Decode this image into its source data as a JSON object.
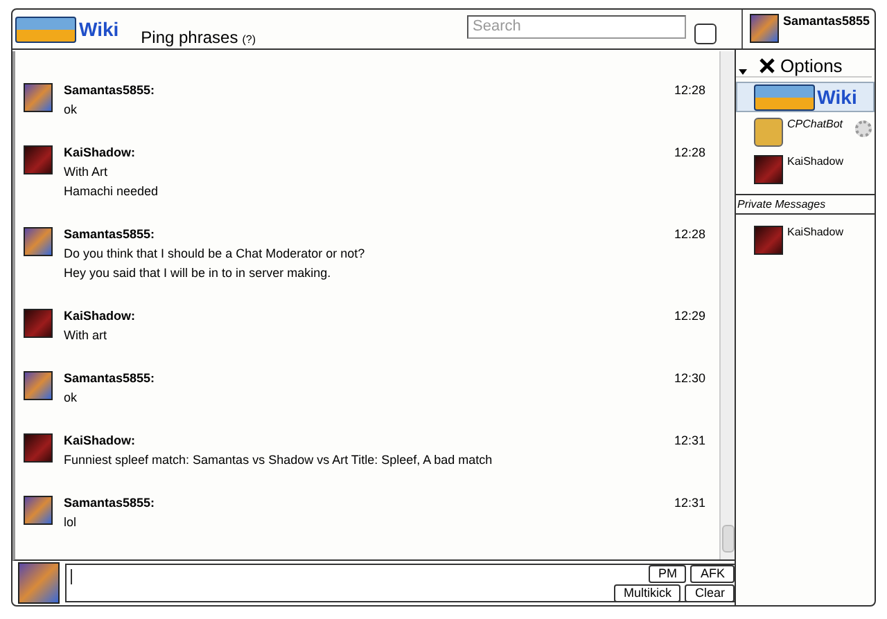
{
  "header": {
    "logo_text": "Wiki",
    "room": "Ping phrases",
    "room_help": "(?)",
    "search": {
      "placeholder": "Search"
    },
    "user": "Samantas5855"
  },
  "messages": [
    {
      "user": "Samantas5855:",
      "time": "12:28",
      "lines": [
        "ok"
      ],
      "kind": "samantas"
    },
    {
      "user": "KaiShadow:",
      "time": "12:28",
      "lines": [
        "With Art",
        "Hamachi needed"
      ],
      "kind": "kai"
    },
    {
      "user": "Samantas5855:",
      "time": "12:28",
      "lines": [
        "Do you think that I should be a Chat Moderator or not?",
        "Hey you said that I will be in to in server making."
      ],
      "kind": "samantas"
    },
    {
      "user": "KaiShadow:",
      "time": "12:29",
      "lines": [
        "With art"
      ],
      "kind": "kai"
    },
    {
      "user": "Samantas5855:",
      "time": "12:30",
      "lines": [
        "ok"
      ],
      "kind": "samantas"
    },
    {
      "user": "KaiShadow:",
      "time": "12:31",
      "lines": [
        "Funniest spleef match: Samantas vs Shadow vs Art Title: Spleef, A bad match"
      ],
      "kind": "kai"
    },
    {
      "user": "Samantas5855:",
      "time": "12:31",
      "lines": [
        "lol"
      ],
      "kind": "samantas"
    }
  ],
  "sidebar": {
    "options": "Options",
    "logo_text": "Wiki",
    "users": [
      {
        "name": "CPChatBot",
        "kind": "bot",
        "italic": true
      },
      {
        "name": "KaiShadow",
        "kind": "kai",
        "italic": false
      }
    ],
    "private_heading": "Private Messages",
    "private": [
      {
        "name": "KaiShadow",
        "kind": "kai"
      }
    ]
  },
  "input": {
    "buttons": [
      "PM",
      "AFK",
      "Multikick",
      "Clear"
    ]
  }
}
